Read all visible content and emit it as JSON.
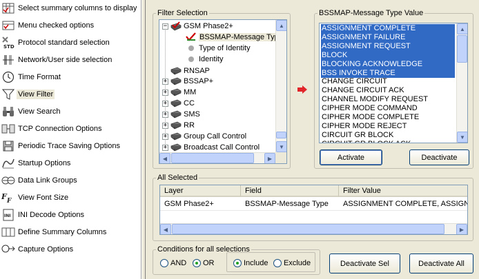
{
  "sidebar": {
    "items": [
      {
        "label": "Select summary columns to display",
        "icon": "columns-icon"
      },
      {
        "label": "Menu checked options",
        "icon": "checked-menu-icon"
      },
      {
        "label": "Protocol standard selection",
        "icon": "std-icon"
      },
      {
        "label": "Network/User side selection",
        "icon": "network-user-icon"
      },
      {
        "label": "Time Format",
        "icon": "clock-icon"
      },
      {
        "label": "View Filter",
        "icon": "filter-icon"
      },
      {
        "label": "View Search",
        "icon": "binoculars-icon"
      },
      {
        "label": "TCP Connection Options",
        "icon": "tcp-icon"
      },
      {
        "label": "Periodic Trace Saving Options",
        "icon": "save-trace-icon"
      },
      {
        "label": "Startup Options",
        "icon": "startup-icon"
      },
      {
        "label": "Data Link Groups",
        "icon": "data-link-icon"
      },
      {
        "label": "View Font Size",
        "icon": "font-size-icon"
      },
      {
        "label": "INI Decode Options",
        "icon": "ini-icon"
      },
      {
        "label": "Define Summary Columns",
        "icon": "define-columns-icon"
      },
      {
        "label": "Capture Options",
        "icon": "capture-icon"
      }
    ],
    "selected_label": "View Filter"
  },
  "filter_selection": {
    "legend": "Filter Selection",
    "tree": [
      {
        "label": "GSM Phase2+",
        "toggle": "−",
        "level": 0,
        "icon": "checked-book-icon"
      },
      {
        "label": "BSSMAP-Message Typ",
        "toggle": "",
        "level": 1,
        "icon": "checkmark-icon",
        "selected": true
      },
      {
        "label": "Type of Identity",
        "toggle": "",
        "level": 1,
        "icon": "gray-dot-icon"
      },
      {
        "label": "Identity",
        "toggle": "",
        "level": 1,
        "icon": "gray-dot-icon"
      },
      {
        "label": "RNSAP",
        "toggle": "",
        "level": 0,
        "icon": "book-icon"
      },
      {
        "label": "BSSAP+",
        "toggle": "+",
        "level": 0,
        "icon": "book-icon"
      },
      {
        "label": "MM",
        "toggle": "+",
        "level": 0,
        "icon": "book-icon"
      },
      {
        "label": "CC",
        "toggle": "+",
        "level": 0,
        "icon": "book-icon"
      },
      {
        "label": "SMS",
        "toggle": "+",
        "level": 0,
        "icon": "book-icon"
      },
      {
        "label": "RR",
        "toggle": "+",
        "level": 0,
        "icon": "book-icon"
      },
      {
        "label": "Group Call Control",
        "toggle": "+",
        "level": 0,
        "icon": "book-icon"
      },
      {
        "label": "Broadcast Call Control",
        "toggle": "+",
        "level": 0,
        "icon": "book-icon"
      }
    ]
  },
  "value_panel": {
    "legend": "BSSMAP-Message Type Value",
    "items": [
      {
        "label": "ASSIGNMENT COMPLETE",
        "selected": true
      },
      {
        "label": "ASSIGNMENT FAILURE",
        "selected": true
      },
      {
        "label": "ASSIGNMENT REQUEST",
        "selected": true
      },
      {
        "label": "BLOCK",
        "selected": true
      },
      {
        "label": "BLOCKING ACKNOWLEDGE",
        "selected": true
      },
      {
        "label": "BSS INVOKE TRACE",
        "selected": true
      },
      {
        "label": "CHANGE CIRCUIT",
        "selected": false
      },
      {
        "label": "CHANGE CIRCUIT ACK",
        "selected": false
      },
      {
        "label": "CHANNEL MODIFY REQUEST",
        "selected": false
      },
      {
        "label": "CIPHER MODE COMMAND",
        "selected": false
      },
      {
        "label": "CIPHER MODE COMPLETE",
        "selected": false
      },
      {
        "label": "CIPHER MODE REJECT",
        "selected": false
      },
      {
        "label": "CIRCUIT GR BLOCK",
        "selected": false
      },
      {
        "label": "CIRCUIT GR BLOCK ACK",
        "selected": false
      }
    ],
    "activate_label": "Activate",
    "deactivate_label": "Deactivate"
  },
  "all_selected": {
    "legend": "All Selected",
    "columns": [
      "Layer",
      "Field",
      "Filter Value"
    ],
    "rows": [
      [
        "GSM Phase2+",
        "BSSMAP-Message Type",
        "ASSIGNMENT COMPLETE, ASSIGN"
      ]
    ]
  },
  "conditions": {
    "legend": "Conditions for all selections",
    "and_label": "AND",
    "or_label": "OR",
    "logic_selected": "OR",
    "include_label": "Include",
    "exclude_label": "Exclude",
    "mode_selected": "Include"
  },
  "actions": {
    "deactivate_sel_label": "Deactivate Sel",
    "deactivate_all_label": "Deactivate All"
  },
  "colors": {
    "selection": "#316ac5",
    "panel_bg": "#ece9d8",
    "accent_red": "#e0262b"
  }
}
